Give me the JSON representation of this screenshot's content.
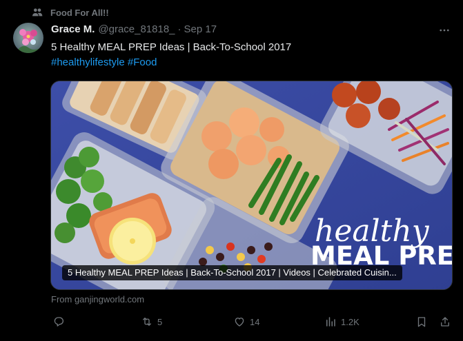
{
  "social_context": {
    "label": "Food For All!!",
    "icon": "people-icon"
  },
  "author": {
    "display_name": "Grace M.",
    "handle": "@grace_81818_",
    "separator": "·",
    "date": "Sep 17"
  },
  "tweet": {
    "text": "5 Healthy MEAL PREP Ideas | Back-To-School 2017",
    "hashtags": [
      "#healthylifestyle",
      "#Food"
    ]
  },
  "media": {
    "title": "5 Healthy MEAL PREP Ideas | Back-To-School 2017 | Videos | Celebrated Cuisin...",
    "image_text_line1": "healthy",
    "image_text_line2": "MEAL PREP",
    "source": "From ganjingworld.com"
  },
  "actions": {
    "reply": {
      "icon": "reply-icon",
      "count": ""
    },
    "retweet": {
      "icon": "retweet-icon",
      "count": "5"
    },
    "like": {
      "icon": "heart-icon",
      "count": "14"
    },
    "views": {
      "icon": "views-chart-icon",
      "count": "1.2K"
    },
    "bookmark": {
      "icon": "bookmark-icon"
    },
    "share": {
      "icon": "share-icon"
    }
  },
  "colors": {
    "background": "#000000",
    "text": "#e7e9ea",
    "muted": "#71767b",
    "link": "#1d9bf0"
  }
}
